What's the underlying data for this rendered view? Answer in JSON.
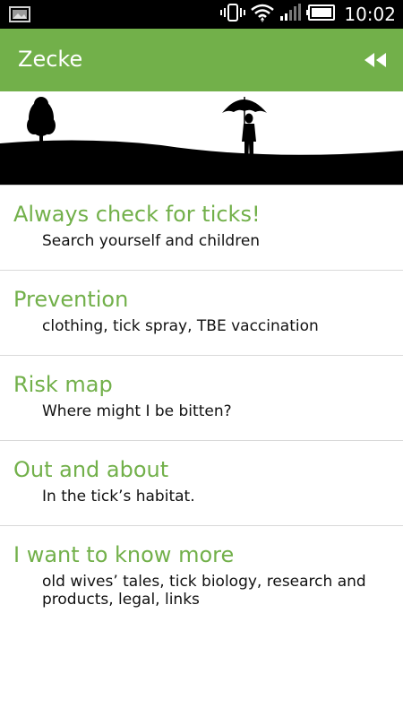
{
  "status_bar": {
    "time": "10:02",
    "icons": [
      "notification-image-icon",
      "vibrate-icon",
      "wifi-icon",
      "signal-icon",
      "battery-icon"
    ]
  },
  "app_bar": {
    "title": "Zecke",
    "action_icon": "rewind-icon",
    "color": "#72b04a"
  },
  "banner": {
    "description_icons": [
      "tree-icon",
      "person-with-umbrella-icon",
      "hill-silhouette"
    ]
  },
  "menu": {
    "items": [
      {
        "title": "Always check for ticks!",
        "subtitle": "Search yourself and children"
      },
      {
        "title": "Prevention",
        "subtitle": "clothing, tick spray, TBE vaccination"
      },
      {
        "title": "Risk map",
        "subtitle": "Where might I be bitten?"
      },
      {
        "title": "Out and about",
        "subtitle": "In the tick’s habitat."
      },
      {
        "title": "I want to know more",
        "subtitle": "old wives’ tales, tick biology, research and products, legal, links"
      }
    ],
    "title_color": "#72b04a"
  }
}
